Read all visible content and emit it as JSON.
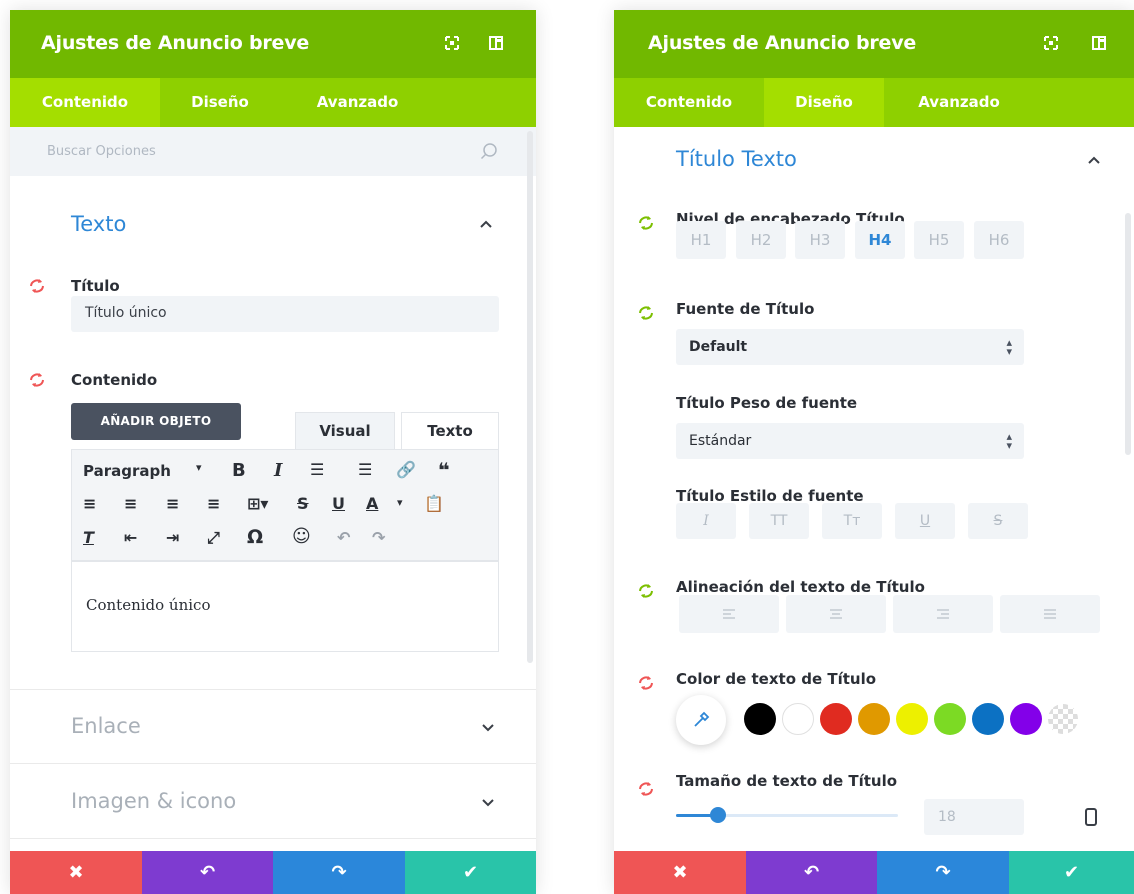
{
  "left": {
    "header": {
      "title": "Ajustes de Anuncio breve"
    },
    "tabs": [
      "Contenido",
      "Diseño",
      "Avanzado"
    ],
    "search": {
      "placeholder": "Buscar Opciones"
    },
    "section_texto": "Texto",
    "titulo_label": "Título",
    "titulo_value": "Título único",
    "contenido_label": "Contenido",
    "add_object": "AÑADIR OBJETO",
    "editor_tabs": [
      "Visual",
      "Texto"
    ],
    "format": "Paragraph",
    "editor_content": "Contenido único",
    "section_enlace": "Enlace",
    "section_imagen": "Imagen & icono"
  },
  "right": {
    "header": {
      "title": "Ajustes de Anuncio breve"
    },
    "tabs": [
      "Contenido",
      "Diseño",
      "Avanzado"
    ],
    "section_title": "Título Texto",
    "heading_level_label": "Nivel de encabezado Título",
    "heading_levels": [
      "H1",
      "H2",
      "H3",
      "H4",
      "H5",
      "H6"
    ],
    "heading_selected": "H4",
    "font_label": "Fuente de Título",
    "font_value": "Default",
    "weight_label": "Título Peso de fuente",
    "weight_value": "Estándar",
    "style_label": "Título Estilo de fuente",
    "style_options": [
      "I",
      "TT",
      "Tт",
      "U",
      "S"
    ],
    "align_label": "Alineación del texto de Título",
    "color_label": "Color de texto de Título",
    "colors": [
      "#000000",
      "#ffffff",
      "#e02b20",
      "#e09900",
      "#edf000",
      "#7cda24",
      "#0c71c3",
      "#8300e9"
    ],
    "size_label": "Tamaño de texto de Título",
    "size_value": "18",
    "size_fraction": 0.19
  },
  "footer_colors": {
    "cancel": "#ef5555",
    "undo": "#7e3bd0",
    "redo": "#2b87da",
    "save": "#29c4a9"
  },
  "accent": "#71b800"
}
